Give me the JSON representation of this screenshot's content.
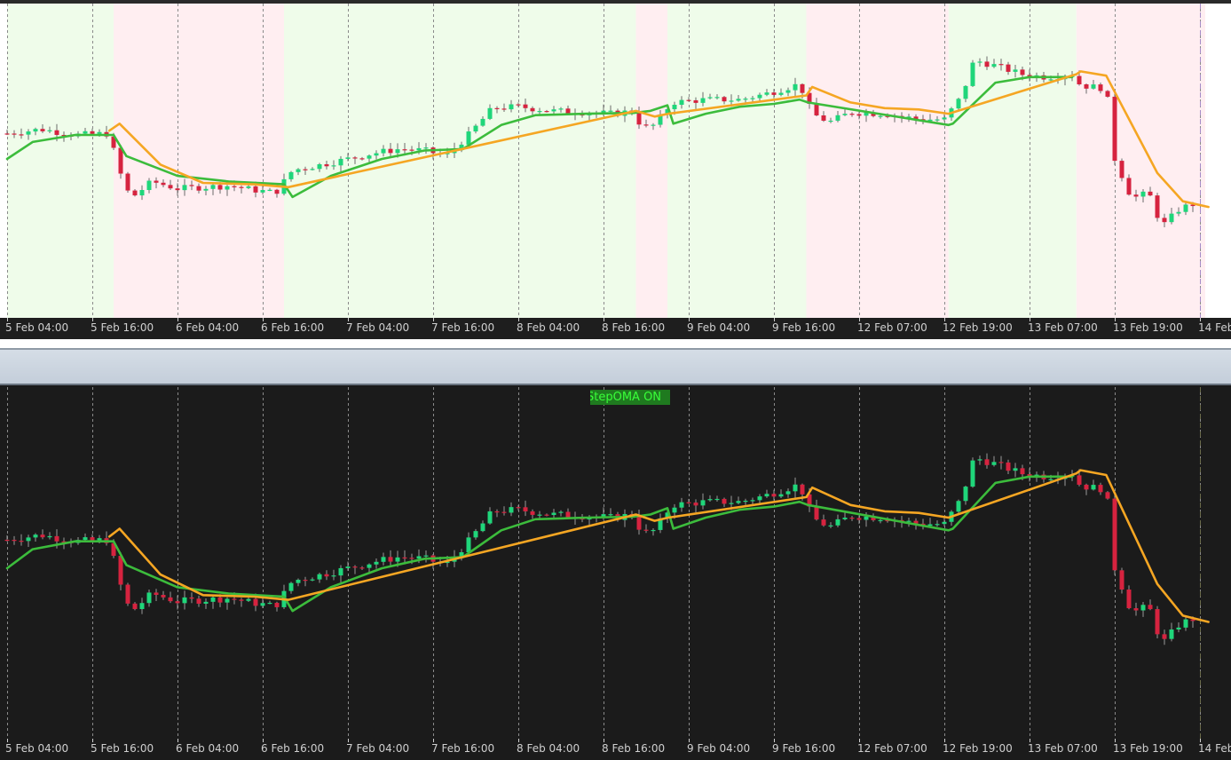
{
  "indicator": {
    "label": "StepOMA ON"
  },
  "colors": {
    "bull": "#1fd67a",
    "bear": "#d6233f",
    "oma_up": "#3cbc3c",
    "oma_down": "#f5a623",
    "zone_up": "#effcea",
    "zone_down": "#ffeef1",
    "top_bg": "#ffffff",
    "bottom_bg": "#1b1b1b"
  },
  "chart_data": {
    "type": "candlestick",
    "x_axis": {
      "labels": [
        "5 Feb 04:00",
        "5 Feb 16:00",
        "6 Feb 04:00",
        "6 Feb 16:00",
        "7 Feb 04:00",
        "7 Feb 16:00",
        "8 Feb 04:00",
        "8 Feb 16:00",
        "9 Feb 04:00",
        "9 Feb 16:00",
        "12 Feb 07:00",
        "12 Feb 19:00",
        "13 Feb 07:00",
        "13 Feb 19:00",
        "14 Feb"
      ],
      "count": 15
    },
    "y_range": [
      0,
      100
    ],
    "trend_zones": [
      {
        "from": 0,
        "to": 1.25,
        "trend": "up"
      },
      {
        "from": 1.25,
        "to": 3.25,
        "trend": "down"
      },
      {
        "from": 3.25,
        "to": 7.38,
        "trend": "up"
      },
      {
        "from": 7.38,
        "to": 7.75,
        "trend": "down"
      },
      {
        "from": 7.75,
        "to": 9.38,
        "trend": "up"
      },
      {
        "from": 9.38,
        "to": 11.05,
        "trend": "down"
      },
      {
        "from": 11.05,
        "to": 12.55,
        "trend": "up"
      },
      {
        "from": 12.55,
        "to": 14.1,
        "trend": "down"
      }
    ],
    "price_anchors": [
      [
        0,
        59
      ],
      [
        0.4,
        60.5
      ],
      [
        0.8,
        58.5
      ],
      [
        1.2,
        59
      ],
      [
        1.3,
        47
      ],
      [
        1.45,
        36
      ],
      [
        1.7,
        42
      ],
      [
        2.0,
        39.5
      ],
      [
        2.3,
        40
      ],
      [
        2.6,
        40.5
      ],
      [
        2.9,
        39
      ],
      [
        3.15,
        38
      ],
      [
        3.35,
        46
      ],
      [
        3.7,
        48
      ],
      [
        4.0,
        50
      ],
      [
        4.3,
        52
      ],
      [
        4.6,
        53.5
      ],
      [
        4.9,
        53
      ],
      [
        5.15,
        51
      ],
      [
        5.4,
        58
      ],
      [
        5.7,
        68
      ],
      [
        6.0,
        68.5
      ],
      [
        6.4,
        67
      ],
      [
        6.8,
        66.5
      ],
      [
        7.1,
        66
      ],
      [
        7.35,
        67
      ],
      [
        7.45,
        61
      ],
      [
        7.6,
        62
      ],
      [
        7.8,
        70
      ],
      [
        8.2,
        71
      ],
      [
        8.6,
        71
      ],
      [
        8.9,
        73
      ],
      [
        9.3,
        76.5
      ],
      [
        9.45,
        66
      ],
      [
        9.65,
        63
      ],
      [
        9.9,
        66.5
      ],
      [
        10.3,
        66
      ],
      [
        10.7,
        64
      ],
      [
        11.0,
        64
      ],
      [
        11.2,
        72
      ],
      [
        11.35,
        85
      ],
      [
        11.6,
        83
      ],
      [
        11.9,
        80
      ],
      [
        12.2,
        79
      ],
      [
        12.5,
        80
      ],
      [
        12.6,
        76
      ],
      [
        12.9,
        75
      ],
      [
        13.0,
        50
      ],
      [
        13.2,
        36
      ],
      [
        13.4,
        38
      ],
      [
        13.55,
        26
      ],
      [
        13.75,
        32
      ],
      [
        13.9,
        34
      ],
      [
        14.1,
        33
      ]
    ],
    "oma_up_anchors": [
      [
        0,
        50
      ],
      [
        0.3,
        56
      ],
      [
        0.8,
        58.5
      ],
      [
        1.25,
        58.5
      ],
      [
        1.4,
        51
      ],
      [
        2.0,
        44
      ],
      [
        2.6,
        42
      ],
      [
        3.25,
        41
      ],
      [
        3.35,
        36.5
      ],
      [
        3.8,
        44
      ],
      [
        4.4,
        50
      ],
      [
        4.9,
        53
      ],
      [
        5.35,
        53.5
      ],
      [
        5.8,
        62
      ],
      [
        6.2,
        65.5
      ],
      [
        6.8,
        66
      ],
      [
        7.35,
        66.3
      ],
      [
        7.55,
        67
      ],
      [
        7.75,
        69
      ],
      [
        7.82,
        62.5
      ],
      [
        8.2,
        66
      ],
      [
        8.6,
        68.5
      ],
      [
        9.0,
        69.5
      ],
      [
        9.3,
        71
      ],
      [
        9.4,
        70
      ],
      [
        11.05,
        62
      ],
      [
        11.1,
        62.5
      ],
      [
        11.6,
        77
      ],
      [
        12.0,
        79
      ],
      [
        12.5,
        79
      ]
    ],
    "oma_down_anchors": [
      [
        1.2,
        60
      ],
      [
        1.32,
        62.5
      ],
      [
        1.8,
        48
      ],
      [
        2.3,
        41.5
      ],
      [
        2.9,
        41
      ],
      [
        3.3,
        40
      ],
      [
        7.38,
        67
      ],
      [
        7.6,
        65
      ],
      [
        7.76,
        66
      ],
      [
        9.38,
        72.5
      ],
      [
        9.45,
        75.5
      ],
      [
        9.9,
        70
      ],
      [
        10.3,
        68
      ],
      [
        10.7,
        67.5
      ],
      [
        11.05,
        66
      ],
      [
        12.55,
        80
      ],
      [
        12.6,
        81
      ],
      [
        12.9,
        79.5
      ],
      [
        13.1,
        68
      ],
      [
        13.5,
        45
      ],
      [
        13.8,
        35
      ],
      [
        14.1,
        33
      ]
    ],
    "series": []
  }
}
